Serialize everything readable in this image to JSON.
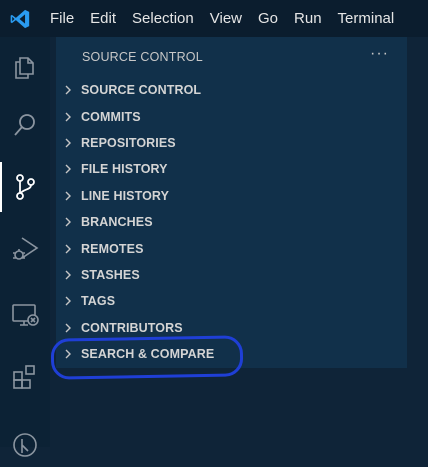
{
  "menubar": {
    "logo_icon": "vscode-logo-icon",
    "items": [
      "File",
      "Edit",
      "Selection",
      "View",
      "Go",
      "Run",
      "Terminal"
    ]
  },
  "activitybar": {
    "icons": [
      "explorer-icon",
      "search-icon",
      "source-control-icon",
      "run-debug-icon",
      "remote-explorer-icon",
      "extensions-icon",
      "gitlens-icon"
    ],
    "active": "source-control-icon"
  },
  "sidebar": {
    "title": "SOURCE CONTROL",
    "more_icon": "ellipsis-icon",
    "sections": [
      "SOURCE CONTROL",
      "COMMITS",
      "REPOSITORIES",
      "FILE HISTORY",
      "LINE HISTORY",
      "BRANCHES",
      "REMOTES",
      "STASHES",
      "TAGS",
      "CONTRIBUTORS",
      "SEARCH & COMPARE"
    ]
  },
  "colors": {
    "highlight_circle": "#1f3fd6",
    "sidebar_bg": "#11304a",
    "active_indicator": "#ffffff"
  }
}
